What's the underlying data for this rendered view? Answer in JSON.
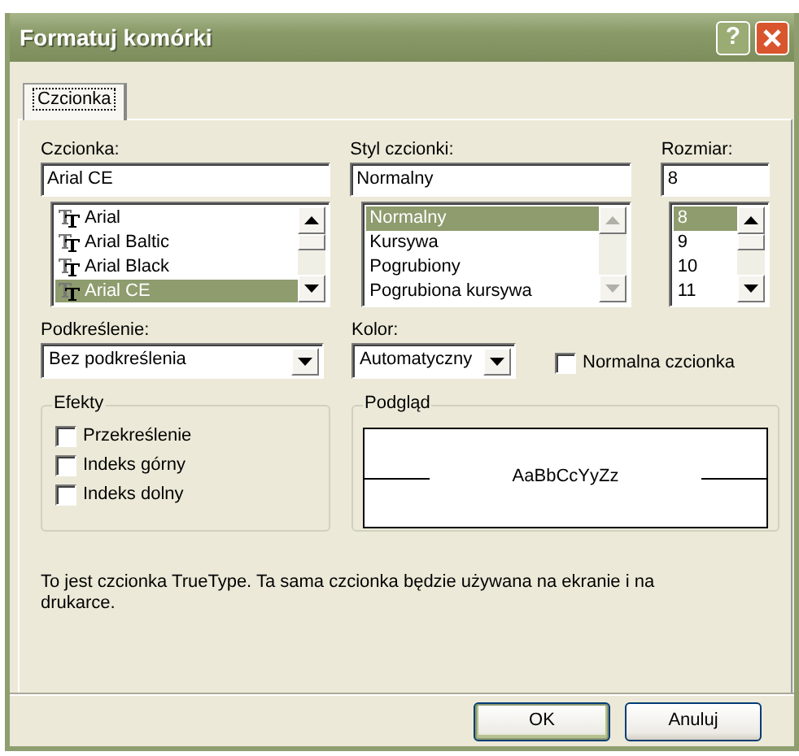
{
  "window": {
    "title": "Formatuj komórki",
    "help": "?"
  },
  "tabs": [
    {
      "label": "Czcionka",
      "selected": true
    }
  ],
  "font": {
    "label": "Czcionka:",
    "value": "Arial CE",
    "scroll_enabled": true,
    "items": [
      {
        "label": "Arial",
        "selected": false
      },
      {
        "label": "Arial Baltic",
        "selected": false
      },
      {
        "label": "Arial Black",
        "selected": false
      },
      {
        "label": "Arial CE",
        "selected": true
      }
    ]
  },
  "style": {
    "label": "Styl czcionki:",
    "value": "Normalny",
    "scroll_enabled": false,
    "items": [
      {
        "label": "Normalny",
        "selected": true
      },
      {
        "label": "Kursywa",
        "selected": false
      },
      {
        "label": "Pogrubiony",
        "selected": false
      },
      {
        "label": "Pogrubiona kursywa",
        "selected": false
      }
    ]
  },
  "size": {
    "label": "Rozmiar:",
    "value": "8",
    "scroll_enabled": true,
    "items": [
      {
        "label": "8",
        "selected": true
      },
      {
        "label": "9",
        "selected": false
      },
      {
        "label": "10",
        "selected": false
      },
      {
        "label": "11",
        "selected": false
      }
    ]
  },
  "underline": {
    "label": "Podkreślenie:",
    "value": "Bez podkreślenia"
  },
  "color": {
    "label": "Kolor:",
    "value": "Automatyczny"
  },
  "normal_font": {
    "label": "Normalna czcionka",
    "checked": false
  },
  "effects": {
    "title": "Efekty",
    "items": [
      {
        "label": "Przekreślenie",
        "checked": false
      },
      {
        "label": "Indeks górny",
        "checked": false
      },
      {
        "label": "Indeks dolny",
        "checked": false
      }
    ]
  },
  "preview": {
    "title": "Podgląd",
    "sample": "AaBbCcYyZz"
  },
  "info": "To jest czcionka TrueType. Ta sama czcionka będzie używana na ekranie i na drukarce.",
  "buttons": [
    {
      "label": "OK",
      "default": true
    },
    {
      "label": "Anuluj",
      "default": false
    }
  ]
}
